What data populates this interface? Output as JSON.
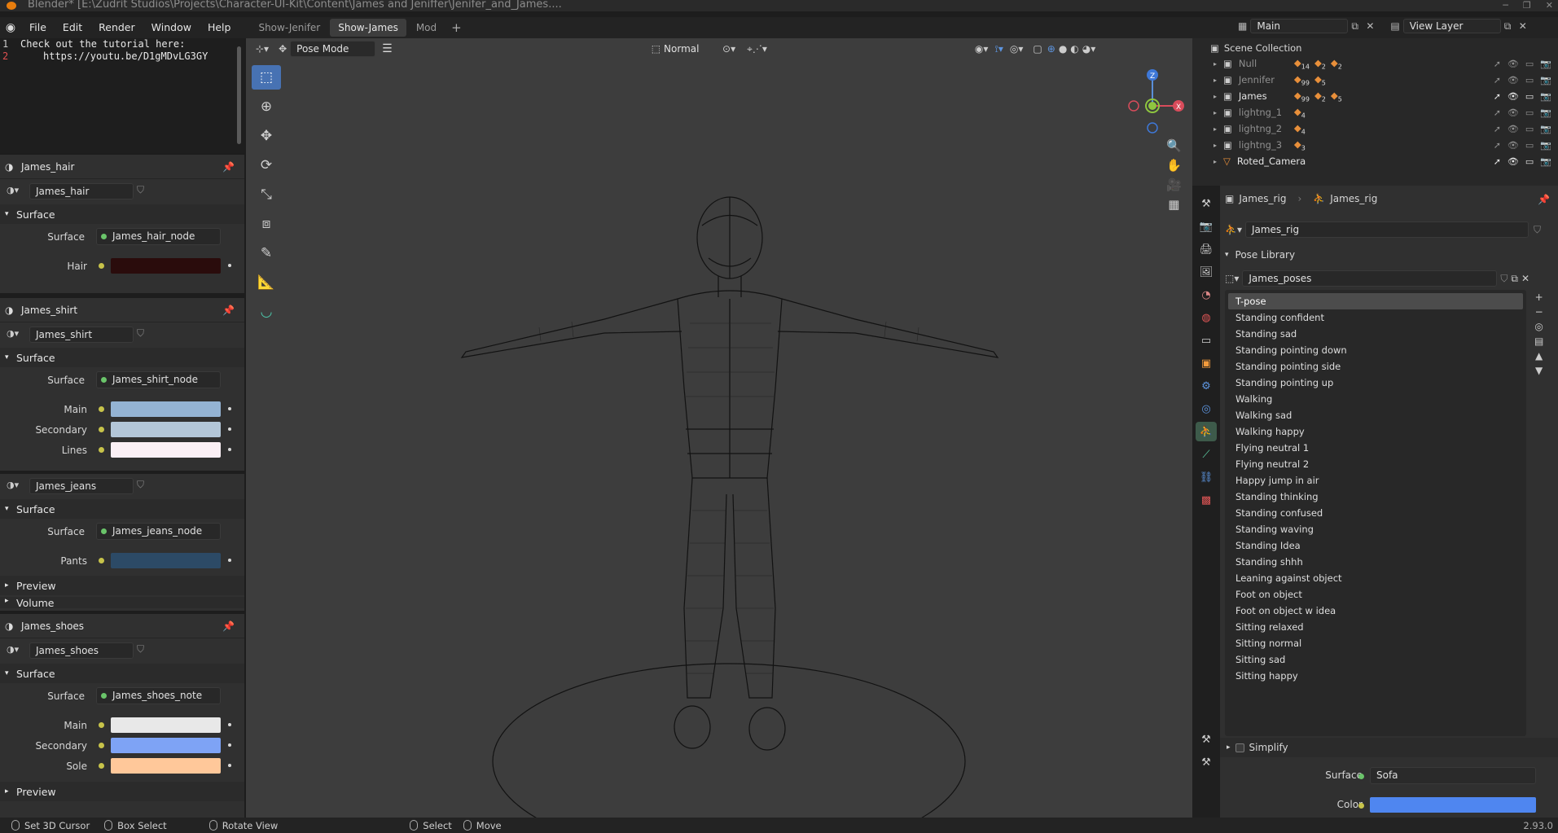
{
  "titlebar": {
    "title": "Blender* [E:\\Zudrit Studios\\Projects\\Character-UI-Kit\\Content\\James and Jeniffer\\Jenifer_and_James...."
  },
  "menubar": {
    "items": [
      "File",
      "Edit",
      "Render",
      "Window",
      "Help"
    ],
    "workspaces": [
      "Show-Jenifer",
      "Show-James",
      "Mod"
    ],
    "active_workspace": "Show-James",
    "scene": "Main",
    "view_layer": "View Layer"
  },
  "text_editor": {
    "line_numbers": [
      "1",
      "2"
    ],
    "line1": "Check out the tutorial here:",
    "line2": "https://youtu.be/D1gMDvLG3GY"
  },
  "materials": {
    "hair": {
      "title": "James_hair",
      "slot": "James_hair",
      "section": "Surface",
      "surface_label": "Surface",
      "node": "James_hair_node",
      "params": [
        {
          "label": "Hair",
          "color": "#2a0c0c"
        }
      ]
    },
    "shirt": {
      "title": "James_shirt",
      "slot": "James_shirt",
      "section": "Surface",
      "surface_label": "Surface",
      "node": "James_shirt_node",
      "params": [
        {
          "label": "Main",
          "color": "#94b3d3"
        },
        {
          "label": "Secondary",
          "color": "#b3c6d8"
        },
        {
          "label": "Lines",
          "color": "#fbf0f5"
        }
      ]
    },
    "jeans": {
      "slot": "James_jeans",
      "section": "Surface",
      "surface_label": "Surface",
      "node": "James_jeans_node",
      "params": [
        {
          "label": "Pants",
          "color": "#2c4a66"
        }
      ],
      "preview": "Preview",
      "volume": "Volume"
    },
    "shoes": {
      "title": "James_shoes",
      "slot": "James_shoes",
      "section": "Surface",
      "surface_label": "Surface",
      "node": "James_shoes_note",
      "params": [
        {
          "label": "Main",
          "color": "#e8e8e8"
        },
        {
          "label": "Secondary",
          "color": "#7ea3f5"
        },
        {
          "label": "Sole",
          "color": "#ffc89a"
        }
      ],
      "preview": "Preview"
    }
  },
  "viewport": {
    "mode": "Pose Mode",
    "orientation": "Normal",
    "gizmo_axes": [
      "Z",
      "X"
    ]
  },
  "outliner": {
    "header": "Scene Collection",
    "rows": [
      {
        "name": "Null",
        "badges": [
          "14",
          "2",
          "2"
        ],
        "active": false
      },
      {
        "name": "Jennifer",
        "badges": [
          "99",
          "5"
        ],
        "active": false
      },
      {
        "name": "James",
        "badges": [
          "99",
          "2",
          "5"
        ],
        "active": true
      },
      {
        "name": "lightng_1",
        "badges": [
          "4"
        ],
        "active": false
      },
      {
        "name": "lightng_2",
        "badges": [
          "4"
        ],
        "active": false
      },
      {
        "name": "lightng_3",
        "badges": [
          "3"
        ],
        "active": false
      },
      {
        "name": "Roted_Camera",
        "badges": [],
        "active": true
      }
    ]
  },
  "properties": {
    "breadcrumb_object": "James_rig",
    "breadcrumb_data": "James_rig",
    "armature_name": "James_rig",
    "pose_library_label": "Pose Library",
    "pose_library_name": "James_poses",
    "poses": [
      "T-pose",
      "Standing confident",
      "Standing sad",
      "Standing pointing down",
      "Standing pointing side",
      "Standing pointing up",
      "Walking",
      "Walking sad",
      "Walking happy",
      "Flying neutral 1",
      "Flying neutral 2",
      "Happy jump in air",
      "Standing thinking",
      "Standing confused",
      "Standing waving",
      "Standing Idea",
      "Standing shhh",
      "Leaning against object",
      "Foot on object",
      "Foot on object w idea",
      "Sitting relaxed",
      "Sitting normal",
      "Sitting sad",
      "Sitting happy"
    ],
    "selected_pose": "T-pose",
    "simplify_label": "Simplify",
    "surface_label": "Surface",
    "surface_value": "Sofa",
    "color_label": "Color",
    "color_value": "#4f86f0"
  },
  "statusbar": {
    "left_click": "Set 3D Cursor",
    "box_select": "Box Select",
    "rotate_view": "Rotate View",
    "select": "Select",
    "move": "Move",
    "version": "2.93.0"
  },
  "colors": {
    "accent": "#4772b3",
    "viewport_bg": "#3d3d3d"
  }
}
